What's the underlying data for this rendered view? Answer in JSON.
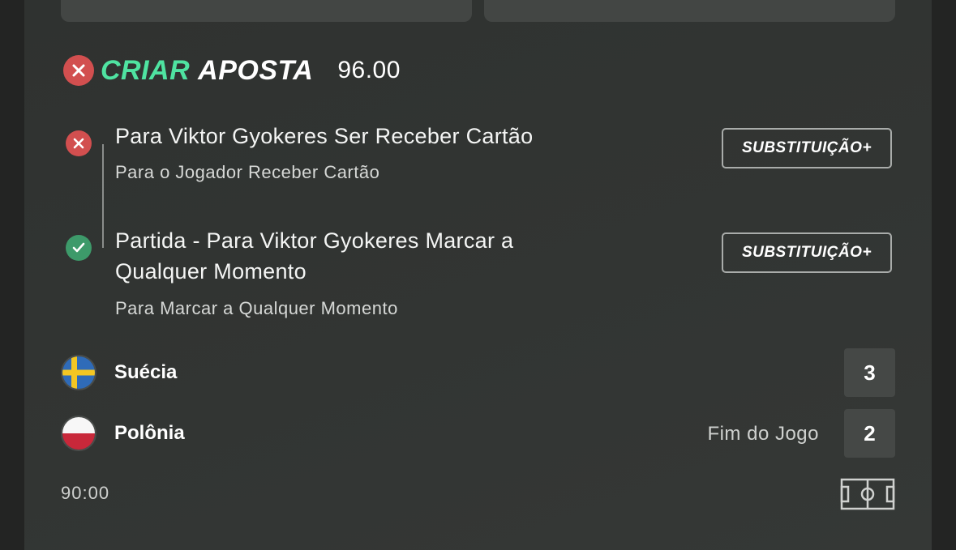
{
  "header": {
    "title_accent": "CRIAR",
    "title_main": "APOSTA",
    "odds": "96.00"
  },
  "legs": [
    {
      "status": "lost",
      "title": "Para Viktor Gyokeres Ser Receber Cartão",
      "subtitle": "Para o Jogador Receber Cartão",
      "button_label": "SUBSTITUIÇÃO+"
    },
    {
      "status": "won",
      "title_line1": "Partida - Para Viktor Gyokeres Marcar a",
      "title_line2": "Qualquer Momento",
      "subtitle": "Para Marcar a Qualquer Momento",
      "button_label": "SUBSTITUIÇÃO+"
    }
  ],
  "match": {
    "home": {
      "name": "Suécia",
      "score": "3",
      "flag_icon": "sweden-flag-icon"
    },
    "away": {
      "name": "Polônia",
      "score": "2",
      "flag_icon": "poland-flag-icon"
    },
    "status": "Fim do Jogo",
    "clock": "90:00"
  },
  "colors": {
    "accent": "#4fe3a1",
    "lost": "#d24f4f",
    "won": "#3d9a6a",
    "card_bg": "#323533"
  }
}
